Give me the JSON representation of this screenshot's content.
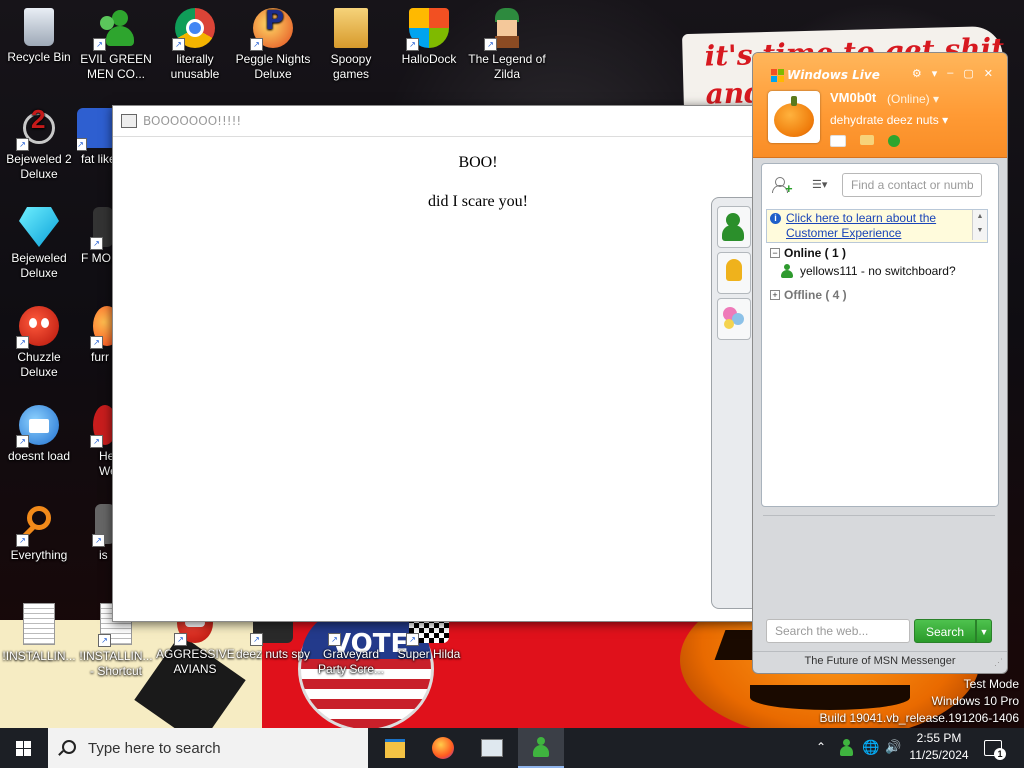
{
  "wallpaper": {
    "poster_text": "it's time to get shit\nand",
    "vote_text": "VOTE"
  },
  "desktop_icons": [
    {
      "label": "Recycle Bin",
      "icon": "recycle-bin-icon"
    },
    {
      "label": "EVIL GREEN MEN CO...",
      "icon": "msn-buddies-icon"
    },
    {
      "label": "literally unusable",
      "icon": "chrome-icon"
    },
    {
      "label": "Peggle Nights Deluxe",
      "icon": "peggle-icon"
    },
    {
      "label": "Spoopy games",
      "icon": "folder-icon"
    },
    {
      "label": "HalloDock",
      "icon": "windows-shield-icon"
    },
    {
      "label": "The Legend of Zilda",
      "icon": "zelda-icon"
    },
    {
      "label": "Bejeweled 2 Deluxe",
      "icon": "bejeweled-2-icon"
    },
    {
      "label": "fat like",
      "icon": "app-icon"
    },
    {
      "label": "Bejeweled Deluxe",
      "icon": "bejeweled-icon"
    },
    {
      "label": "F MON",
      "icon": "app-icon"
    },
    {
      "label": "Chuzzle Deluxe",
      "icon": "chuzzle-icon"
    },
    {
      "label": "furr",
      "icon": "firefox-icon"
    },
    {
      "label": "doesnt load",
      "icon": "thunderbird-icon"
    },
    {
      "label": "He We",
      "icon": "app-icon"
    },
    {
      "label": "Everything",
      "icon": "everything-search-icon"
    },
    {
      "label": "is",
      "icon": "app-icon"
    },
    {
      "label": "!INSTALLIN...",
      "icon": "text-file-icon"
    },
    {
      "label": "!INSTALLIN... - Shortcut",
      "icon": "text-file-icon"
    },
    {
      "label": "AGGRESSIVE AVIANS",
      "icon": "angry-birds-icon"
    },
    {
      "label": "deez nuts spy",
      "icon": "app-icon"
    },
    {
      "label": "Graveyard Party Scre...",
      "icon": "app-icon"
    },
    {
      "label": "Super Hilda",
      "icon": "app-icon"
    }
  ],
  "boo_window": {
    "title": "BOOOOOOO!!!!!",
    "heading": "BOO!",
    "body": "did I scare you!"
  },
  "msn": {
    "logo": "Windows Live",
    "display_name": "VM0b0t",
    "status": "(Online)",
    "personal_message": "dehydrate deez nuts",
    "find_placeholder": "Find a contact or number",
    "banner_link": "Click here to learn about the Customer Experience",
    "groups": {
      "online": "Online ( 1 )",
      "offline": "Offline ( 4 )"
    },
    "contacts": [
      {
        "name": "yellows111 - no switchboard?",
        "status": "online"
      }
    ],
    "web_search_placeholder": "Search the web...",
    "search_button": "Search",
    "footer": "The Future of MSN Messenger",
    "accent_color": "#ff9a34"
  },
  "taskbar": {
    "search_placeholder": "Type here to search",
    "apps": [
      "file-explorer-icon",
      "firefox-icon",
      "control-panel-icon",
      "msn-messenger-icon"
    ],
    "clock_time": "2:55 PM",
    "clock_date": "11/25/2024",
    "notification_count": "1"
  },
  "watermark": {
    "line1": "Test Mode",
    "line2": "Windows 10 Pro",
    "line3": "Build 19041.vb_release.191206-1406"
  }
}
